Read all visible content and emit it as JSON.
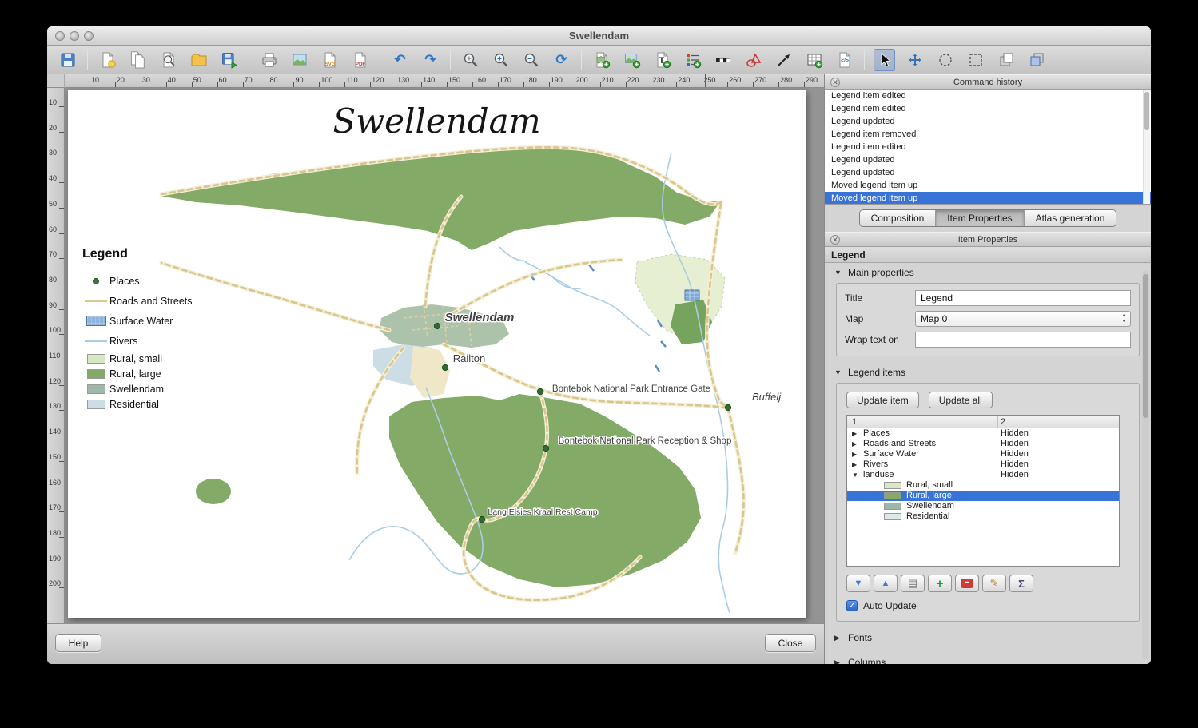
{
  "window": {
    "title": "Swellendam"
  },
  "toolbar": {
    "icons": [
      "save",
      "new-composition",
      "duplicate-composition",
      "composition-manager",
      "load-from-template",
      "save-as-template",
      "print",
      "export-as-image",
      "export-as-svg",
      "export-as-pdf",
      "undo",
      "redo",
      "zoom-full",
      "zoom-in",
      "zoom-out",
      "refresh-view",
      "add-new-map",
      "add-image",
      "add-new-label",
      "add-new-legend",
      "add-new-scalebar",
      "add-basic-shape",
      "add-arrow",
      "add-attribute-table",
      "add-html-frame",
      "select-move-item",
      "move-item-content",
      "select-zoom-region",
      "pan-composer",
      "raise-selected-items",
      "lower-selected-items"
    ],
    "icon_badges": {
      "svg": "SVG",
      "pdf": "PDF",
      "label": "T",
      "html": "</>"
    }
  },
  "rulers": {
    "horizontal": [
      "10",
      "20",
      "30",
      "40",
      "50",
      "60",
      "70",
      "80",
      "90",
      "100",
      "110",
      "120",
      "130",
      "140",
      "150",
      "160",
      "170",
      "180",
      "190",
      "200",
      "210",
      "220",
      "230",
      "240",
      "250",
      "260",
      "270",
      "280",
      "290"
    ],
    "vertical": [
      "10",
      "20",
      "30",
      "40",
      "50",
      "60",
      "70",
      "80",
      "90",
      "100",
      "110",
      "120",
      "130",
      "140",
      "150",
      "160",
      "170",
      "180",
      "190",
      "200"
    ]
  },
  "page": {
    "map_title": "Swellendam",
    "legend": {
      "title": "Legend",
      "items": [
        {
          "label": "Places",
          "symbol": "point",
          "color": "#3a7a40"
        },
        {
          "label": "Roads and Streets",
          "symbol": "line",
          "color": "#dbc98f"
        },
        {
          "label": "Surface Water",
          "symbol": "polygon",
          "color": "#8fb4d9"
        },
        {
          "label": "Rivers",
          "symbol": "line",
          "color": "#a9cde6"
        },
        {
          "label": "Rural, small",
          "symbol": "polygon",
          "color": "#d8e8c2"
        },
        {
          "label": "Rural, large",
          "symbol": "polygon",
          "color": "#84aa67"
        },
        {
          "label": "Swellendam",
          "symbol": "polygon",
          "color": "#9db8a8"
        },
        {
          "label": "Residential",
          "symbol": "polygon",
          "color": "#ccdde6"
        }
      ]
    },
    "map_labels": {
      "town": "Swellendam",
      "railton": "Railton",
      "entrance_gate": "Bontebok National Park Entrance Gate",
      "reception": "Bontebok National Park Reception & Shop",
      "rest_camp": "Lang Elsies Kraal Rest Camp",
      "buffeljags": "Buffelj"
    }
  },
  "command_history": {
    "title": "Command history",
    "items": [
      "Legend item edited",
      "Legend item edited",
      "Legend updated",
      "Legend item removed",
      "Legend item edited",
      "Legend updated",
      "Legend updated",
      "Moved legend item up",
      "Moved legend item up"
    ],
    "selected_index": 8
  },
  "tabs": {
    "composition": "Composition",
    "item_properties": "Item Properties",
    "atlas": "Atlas generation",
    "selected": "Item Properties"
  },
  "item_properties": {
    "panel_title": "Item Properties",
    "item_type_label": "Legend",
    "main_properties": {
      "section_label": "Main properties",
      "title_label": "Title",
      "title_value": "Legend",
      "map_label": "Map",
      "map_value": "Map 0",
      "wrap_label": "Wrap text on",
      "wrap_value": ""
    },
    "legend_items": {
      "section_label": "Legend items",
      "update_item_label": "Update item",
      "update_all_label": "Update all",
      "columns": [
        "1",
        "2"
      ],
      "rows": [
        {
          "label": "Places",
          "value": "Hidden",
          "expander": "collapsed"
        },
        {
          "label": "Roads and Streets",
          "value": "Hidden",
          "expander": "collapsed"
        },
        {
          "label": "Surface Water",
          "value": "Hidden",
          "expander": "collapsed"
        },
        {
          "label": "Rivers",
          "value": "Hidden",
          "expander": "collapsed"
        },
        {
          "label": "landuse",
          "value": "Hidden",
          "expander": "expanded"
        },
        {
          "label": "Rural, small",
          "value": "",
          "swatch": "#d9e7c7"
        },
        {
          "label": "Rural, large",
          "value": "",
          "swatch": "#84aa67",
          "selected": true
        },
        {
          "label": "Swellendam",
          "value": "",
          "swatch": "#9db8a8"
        },
        {
          "label": "Residential",
          "value": "",
          "swatch": "#dce8ea"
        }
      ],
      "auto_update_label": "Auto Update",
      "auto_update_checked": true
    },
    "fonts_label": "Fonts",
    "columns_label": "Columns"
  },
  "footer": {
    "help_label": "Help",
    "close_label": "Close"
  },
  "colors": {
    "selection_blue": "#3874d8",
    "rural_large_green": "#84aa67",
    "road_tan": "#d9c68c",
    "river_blue": "#a9cde6"
  }
}
